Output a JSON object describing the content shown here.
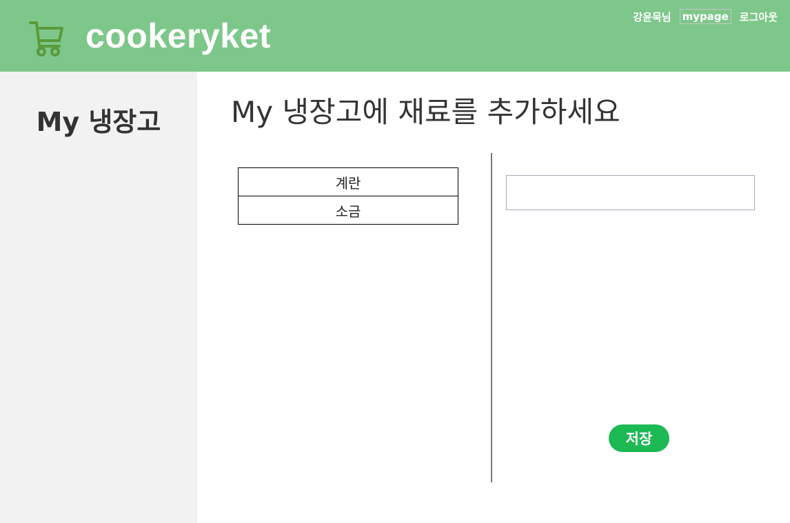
{
  "header": {
    "brand": "cookeryket",
    "cart_icon": "shopping-cart-icon",
    "user_name": "강윤묵님",
    "mypage_label": "mypage",
    "logout_label": "로그아웃"
  },
  "sidebar": {
    "title": "My 냉장고"
  },
  "main": {
    "title": "My 냉장고에 재료를 추가하세요",
    "ingredients": [
      "계란",
      "소금"
    ],
    "input": {
      "value": "",
      "placeholder": ""
    },
    "save_label": "저장"
  },
  "colors": {
    "header_bg": "#7dc78a",
    "sidebar_bg": "#f2f2f2",
    "save_button": "#1db954",
    "cart_icon": "#5a9a3a"
  }
}
